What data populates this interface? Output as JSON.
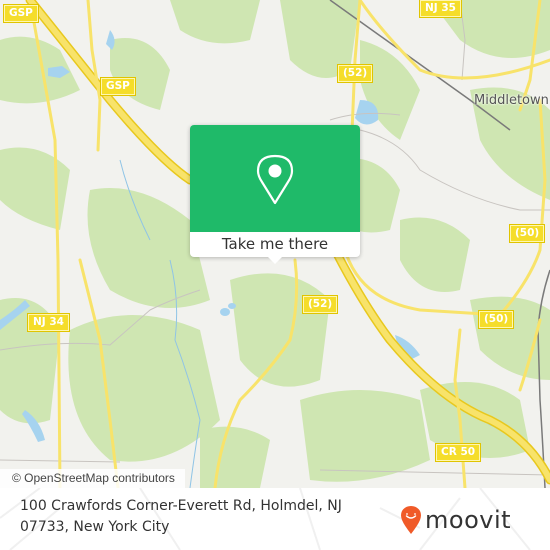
{
  "map": {
    "attribution": "© OpenStreetMap contributors",
    "place_labels": [
      {
        "name": "Middletown"
      }
    ],
    "road_shields": [
      {
        "id": "gsp-1",
        "label": "GSP"
      },
      {
        "id": "gsp-2",
        "label": "GSP"
      },
      {
        "id": "nj35",
        "label": "NJ 35"
      },
      {
        "id": "r52-north",
        "label": "(52)"
      },
      {
        "id": "r52-south",
        "label": "(52)"
      },
      {
        "id": "r50-a",
        "label": "(50)"
      },
      {
        "id": "r50-b",
        "label": "(50)"
      },
      {
        "id": "nj34",
        "label": "NJ 34"
      },
      {
        "id": "cr50",
        "label": "CR 50"
      }
    ],
    "colors": {
      "land": "#f2f2ee",
      "forest": "#cfe6b2",
      "water": "#a6d3ef",
      "highway": "#f5dd2a",
      "rail": "#777777"
    }
  },
  "popup": {
    "cta_label": "Take me there",
    "icon": "map-pin-icon",
    "color": "#1fba69"
  },
  "footer": {
    "address": "100 Crawfords Corner-Everett Rd, Holmdel, NJ 07733, New York City",
    "brand": "moovit",
    "brand_color": "#f05a28"
  }
}
